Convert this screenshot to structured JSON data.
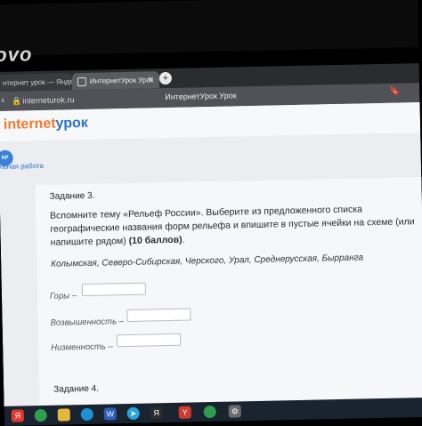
{
  "laptop": {
    "brand": "ovo"
  },
  "tabs": [
    {
      "label": "нтернет урок — Яндекс",
      "active": false
    },
    {
      "label": "ИнтернетУрок Урок",
      "active": true
    }
  ],
  "address_bar": {
    "url": "interneturok.ru",
    "page_title": "ИнтернетУрок Урок"
  },
  "site": {
    "brand_part1": "internet",
    "brand_part2": "урок",
    "badge": "КР",
    "section_label": "льная работа"
  },
  "task": {
    "title": "Задание 3.",
    "text_line1": "Вспомните тему «Рельеф России». Выберите из предложенного списка",
    "text_line2": "географические названия форм рельефа и впишите в пустые ячейки на схеме (или",
    "text_line3": "напишите рядом)",
    "points": "(10 баллов)",
    "period": ".",
    "options": "Колымская, Северо-Сибирская, Черского, Урал, Среднерусская, Бырранга",
    "rows": [
      {
        "label": "Горы –",
        "value": ""
      },
      {
        "label": "Возвышенность –",
        "value": ""
      },
      {
        "label": "Низменность –",
        "value": ""
      }
    ],
    "next_title": "Задание 4."
  },
  "colors": {
    "brand_orange": "#f07a2a",
    "brand_blue": "#2d71c9",
    "page_background": "#ebedf0"
  },
  "taskbar_icons": [
    "yandex-browser-icon",
    "chrome-icon",
    "folder-icon",
    "edge-icon",
    "word-icon",
    "telegram-icon",
    "yandex-icon",
    "chrome-icon",
    "settings-icon"
  ]
}
